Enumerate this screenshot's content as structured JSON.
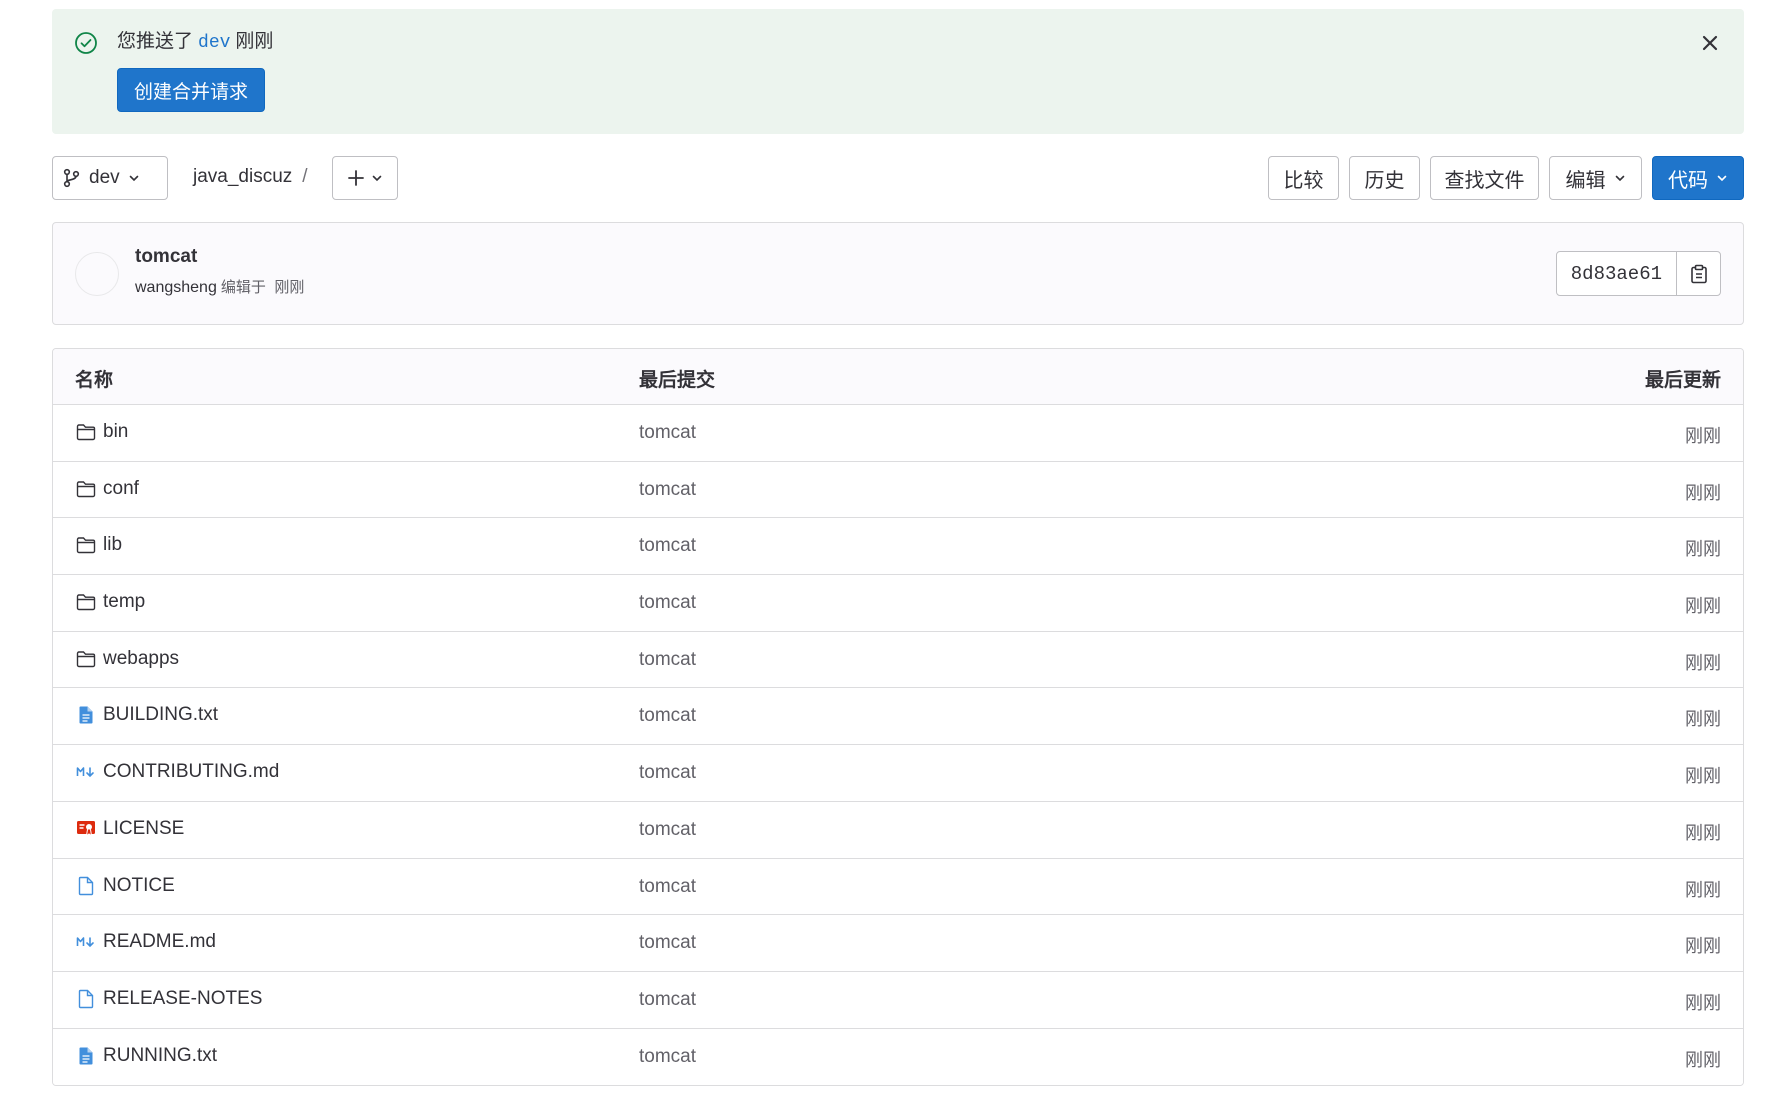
{
  "alert": {
    "message_prefix": "您推送了",
    "branch": "dev",
    "message_suffix": "刚刚",
    "create_mr_label": "创建合并请求"
  },
  "toolbar": {
    "branch": "dev",
    "project": "java_discuz",
    "separator": "/",
    "compare_label": "比较",
    "history_label": "历史",
    "find_file_label": "查找文件",
    "edit_label": "编辑",
    "code_label": "代码"
  },
  "last_commit": {
    "title": "tomcat",
    "author": "wangsheng",
    "action": "编辑于",
    "time": "刚刚",
    "sha": "8d83ae61"
  },
  "table": {
    "headers": {
      "name": "名称",
      "last_commit": "最后提交",
      "last_update": "最后更新"
    },
    "rows": [
      {
        "name": "bin",
        "icon": "folder-icon",
        "commit": "tomcat",
        "updated": "刚刚"
      },
      {
        "name": "conf",
        "icon": "folder-icon",
        "commit": "tomcat",
        "updated": "刚刚"
      },
      {
        "name": "lib",
        "icon": "folder-icon",
        "commit": "tomcat",
        "updated": "刚刚"
      },
      {
        "name": "temp",
        "icon": "folder-icon",
        "commit": "tomcat",
        "updated": "刚刚"
      },
      {
        "name": "webapps",
        "icon": "folder-icon",
        "commit": "tomcat",
        "updated": "刚刚"
      },
      {
        "name": "BUILDING.txt",
        "icon": "text-file-icon",
        "commit": "tomcat",
        "updated": "刚刚"
      },
      {
        "name": "CONTRIBUTING.md",
        "icon": "markdown-icon",
        "commit": "tomcat",
        "updated": "刚刚"
      },
      {
        "name": "LICENSE",
        "icon": "license-icon",
        "commit": "tomcat",
        "updated": "刚刚"
      },
      {
        "name": "NOTICE",
        "icon": "file-icon",
        "commit": "tomcat",
        "updated": "刚刚"
      },
      {
        "name": "README.md",
        "icon": "markdown-icon",
        "commit": "tomcat",
        "updated": "刚刚"
      },
      {
        "name": "RELEASE-NOTES",
        "icon": "file-icon",
        "commit": "tomcat",
        "updated": "刚刚"
      },
      {
        "name": "RUNNING.txt",
        "icon": "text-file-icon",
        "commit": "tomcat",
        "updated": "刚刚"
      }
    ]
  },
  "colors": {
    "primary": "#1f75cb",
    "alert_bg": "#ecf4ee",
    "success": "#108548",
    "license": "#dd2b0e"
  }
}
